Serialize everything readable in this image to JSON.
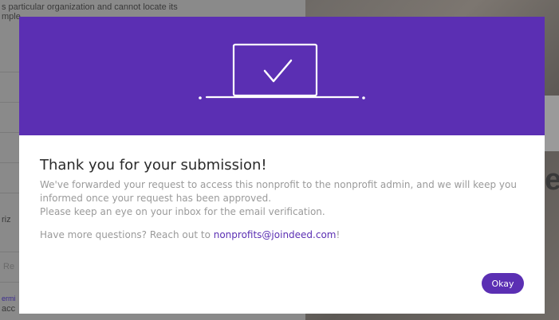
{
  "background": {
    "text_top_line1": "s particular organization and cannot locate its",
    "text_top_line2": "mple",
    "text_left_1": "riz",
    "text_left_2": "Re",
    "text_bottom_1": "ermi",
    "text_bottom_2": "acc",
    "right_letters": "e"
  },
  "modal": {
    "title": "Thank you for your submission!",
    "body_line1": "We've forwarded your request to access this nonprofit to the nonprofit admin, and we will keep you informed once your request has been approved.",
    "body_line2": "Please keep an eye on your inbox for the email verification.",
    "help_prefix": "Have more questions? Reach out to ",
    "help_email": "nonprofits@joindeed.com",
    "help_suffix": "!",
    "okay_label": "Okay"
  },
  "colors": {
    "brand_purple": "#5b2fb3",
    "overlay_gray": "#8a8a8a"
  },
  "icons": {
    "illustration": "laptop-checkmark-icon"
  }
}
